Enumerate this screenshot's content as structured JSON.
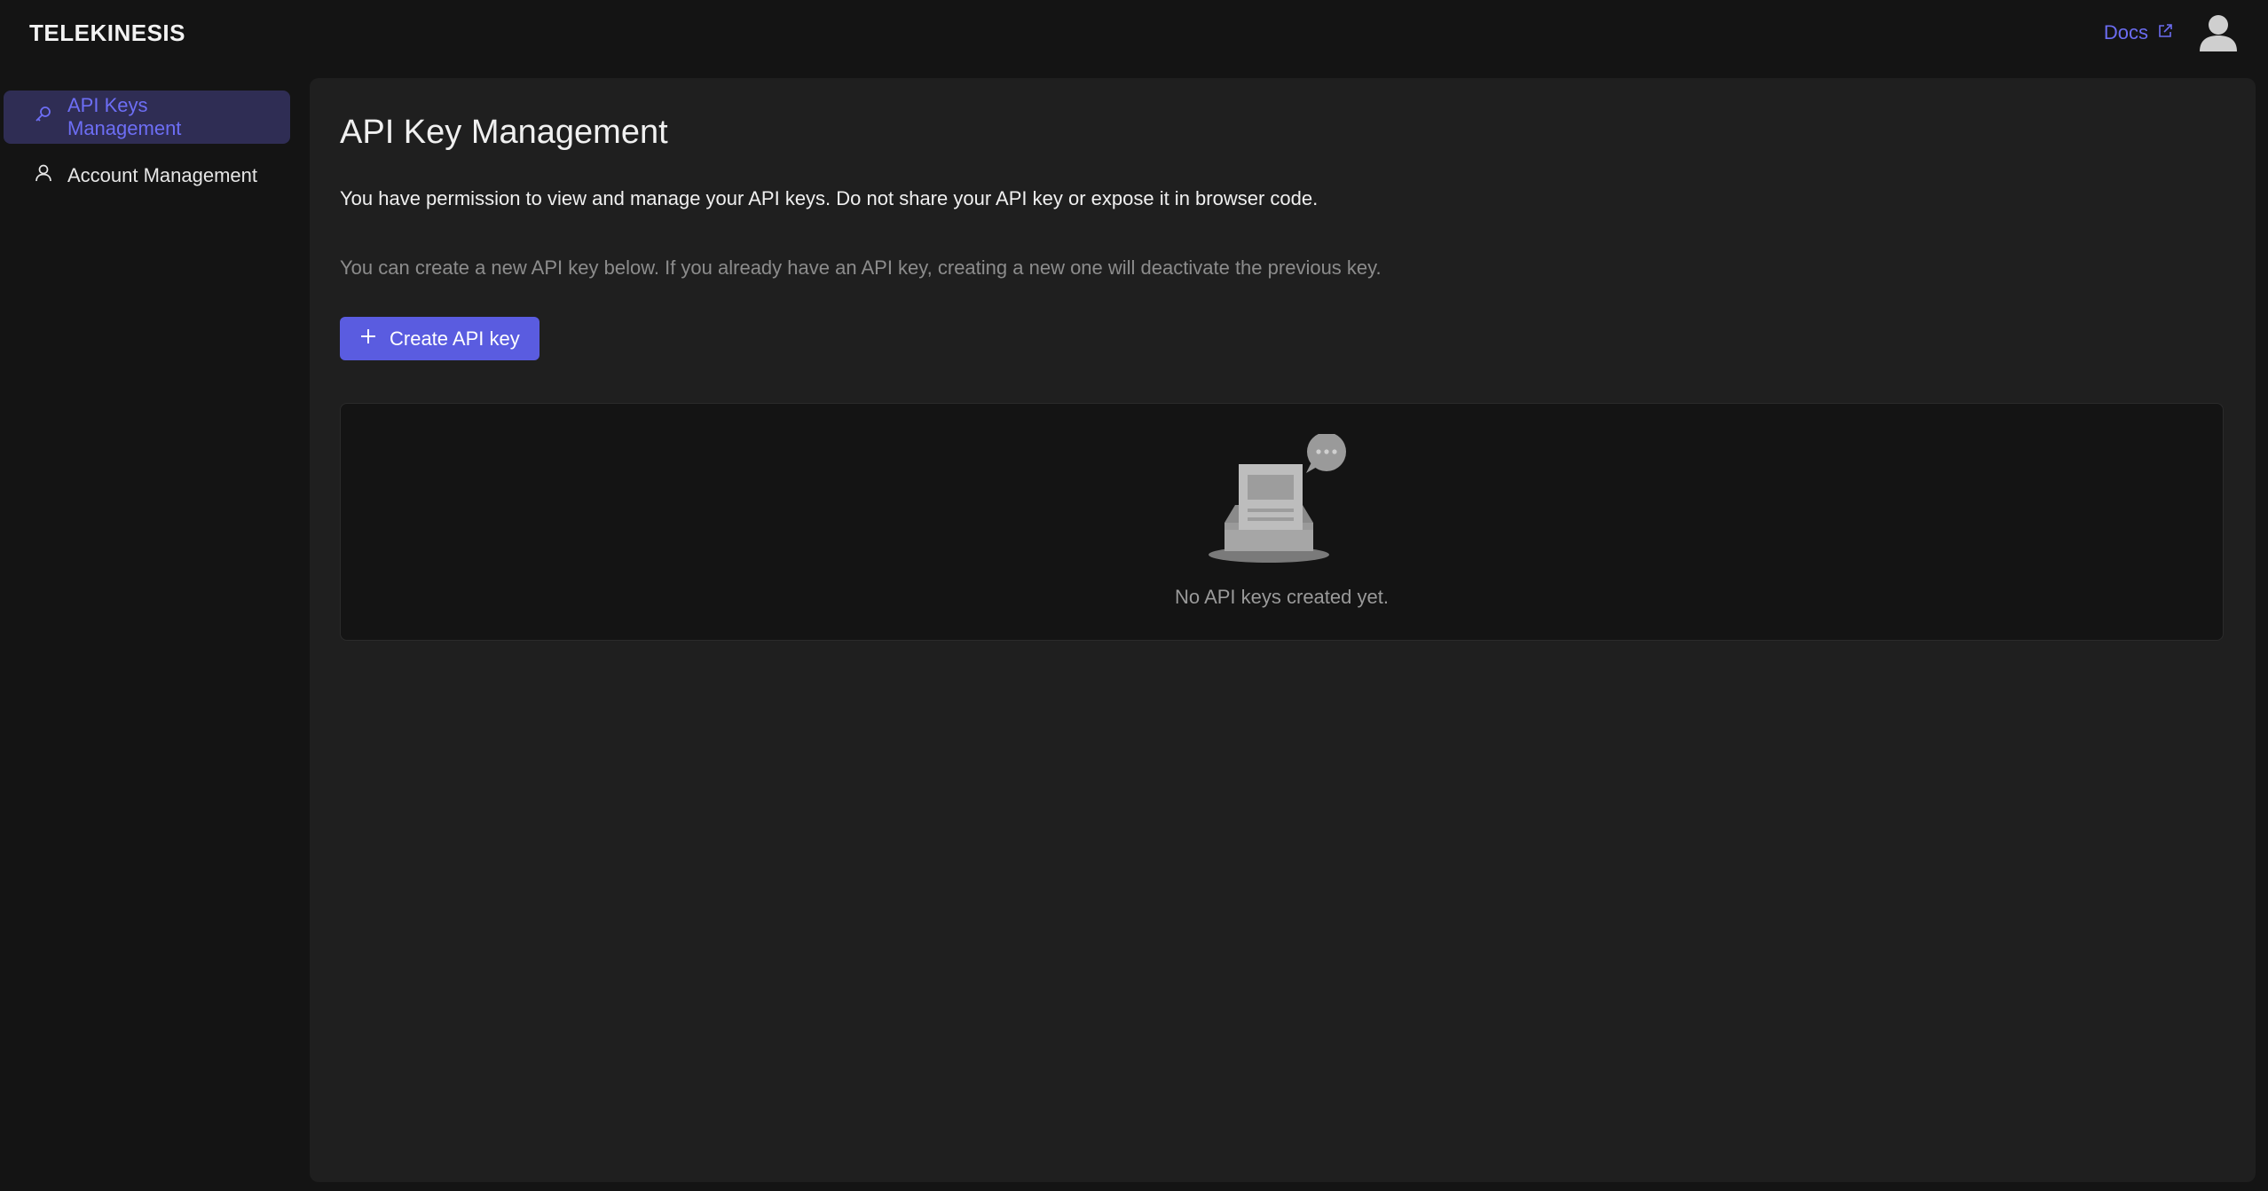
{
  "app": {
    "brand": "TELEKINESIS"
  },
  "header": {
    "docs_label": "Docs"
  },
  "sidebar": {
    "items": [
      {
        "label": "API Keys Management",
        "icon": "key-icon",
        "active": true
      },
      {
        "label": "Account Management",
        "icon": "user-icon",
        "active": false
      }
    ]
  },
  "main": {
    "title": "API Key Management",
    "intro": "You have permission to view and manage your API keys. Do not share your API key or expose it in browser code.",
    "note": "You can create a new API key below. If you already have an API key, creating a new one will deactivate the previous key.",
    "create_button": "Create API key",
    "empty_message": "No API keys created yet."
  },
  "colors": {
    "accent": "#5a5ce0",
    "accent_text": "#6d6ef5",
    "background": "#141414",
    "panel": "#1f1f1f"
  }
}
